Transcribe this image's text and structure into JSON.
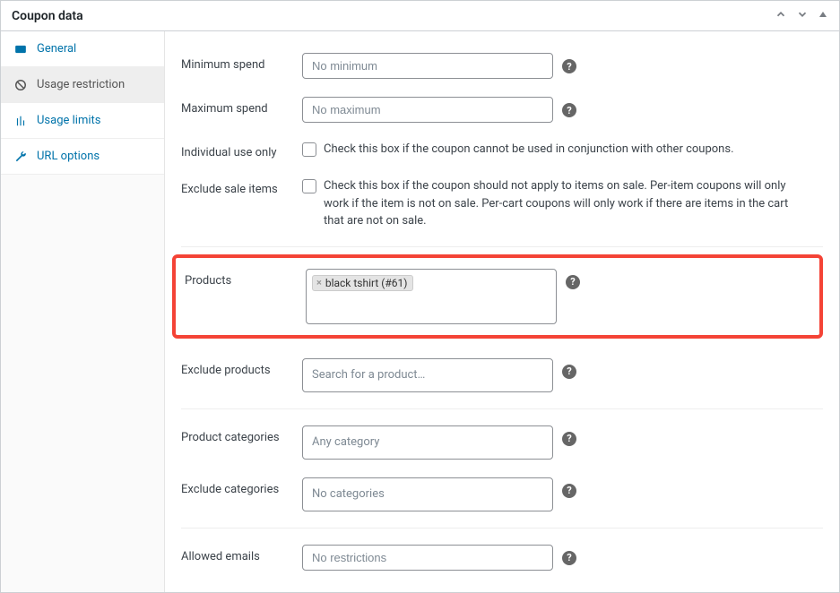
{
  "header": {
    "title": "Coupon data"
  },
  "sidebar": {
    "items": [
      {
        "label": "General"
      },
      {
        "label": "Usage restriction"
      },
      {
        "label": "Usage limits"
      },
      {
        "label": "URL options"
      }
    ]
  },
  "fields": {
    "min_spend": {
      "label": "Minimum spend",
      "placeholder": "No minimum"
    },
    "max_spend": {
      "label": "Maximum spend",
      "placeholder": "No maximum"
    },
    "individual_use": {
      "label": "Individual use only",
      "desc": "Check this box if the coupon cannot be used in conjunction with other coupons."
    },
    "exclude_sale": {
      "label": "Exclude sale items",
      "desc": "Check this box if the coupon should not apply to items on sale. Per-item coupons will only work if the item is not on sale. Per-cart coupons will only work if there are items in the cart that are not on sale."
    },
    "products": {
      "label": "Products",
      "tag": "black tshirt (#61)"
    },
    "exclude_products": {
      "label": "Exclude products",
      "placeholder": "Search for a product…"
    },
    "product_categories": {
      "label": "Product categories",
      "placeholder": "Any category"
    },
    "exclude_categories": {
      "label": "Exclude categories",
      "placeholder": "No categories"
    },
    "allowed_emails": {
      "label": "Allowed emails",
      "placeholder": "No restrictions"
    }
  }
}
